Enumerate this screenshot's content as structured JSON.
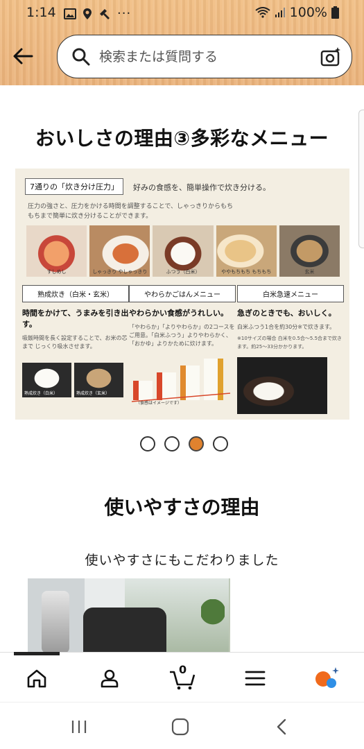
{
  "status_bar": {
    "time": "1:14",
    "battery_text": "100%",
    "left_icons": [
      "image-icon",
      "location-icon",
      "hammer-icon",
      "more-dots-icon"
    ],
    "right_icons": [
      "wifi-icon",
      "signal-icon",
      "battery-icon"
    ],
    "more": "···"
  },
  "header": {
    "search_placeholder": "検索または質問する",
    "background_color": "#eeb87f"
  },
  "section1": {
    "title": "おいしさの理由③多彩なメニュー",
    "panel": {
      "title": "7通りの「炊き分け圧力」",
      "title_side": "好みの食感を、簡単操作で炊き分ける。",
      "description": "圧力の強さと、圧力をかける時間を調整することで、しゃっきりからもちもちまで簡単に炊き分けることができます。",
      "foods": [
        "すしめし",
        "しゃっきり やしゃっきり",
        "ふつう（白米）",
        "ややもちもち もちもち",
        "玄米"
      ],
      "columns": [
        {
          "header": "熟成炊き（白米・玄米）",
          "headline": "時間をかけて、うまみを引き出す。",
          "text": "吸飯時間を長く設定することで、お米の芯まで じっくり吸水させます。",
          "captions": [
            "熟成炊き（白米）",
            "熟成炊き（玄米）"
          ]
        },
        {
          "header": "やわらかごはんメニュー",
          "headline": "やわらかい食感がうれしい。",
          "text": "「やわらか」「よりやわらか」の2コースをご用意。「白米ふつう」よりやわらかく、「おかゆ」よりかために炊けます。",
          "bars": [
            "白米ふつう",
            "やわらか",
            "よりやわらか",
            "おかゆ"
          ],
          "note": "（食感はイメージです）"
        },
        {
          "header": "白米急速メニュー",
          "headline": "急ぎのときでも、おいしく。",
          "text": "白米ふつう1合を約30分※で炊きます。",
          "note": "※10サイズの場合 白米を0.5合〜5.5合まで炊きます。約25〜33分かかります。"
        }
      ]
    },
    "carousel": {
      "count": 4,
      "active_index": 2,
      "active_color": "#e0822e"
    }
  },
  "section2": {
    "title": "使いやすさの理由",
    "subtitle": "使いやすさにもこだわりました"
  },
  "bottom_nav": {
    "items": [
      "home-icon",
      "account-icon",
      "cart-icon",
      "menu-icon",
      "assistant-icon"
    ],
    "cart_count": "0"
  },
  "system_nav": [
    "recent-apps-icon",
    "home-button-icon",
    "back-icon"
  ]
}
